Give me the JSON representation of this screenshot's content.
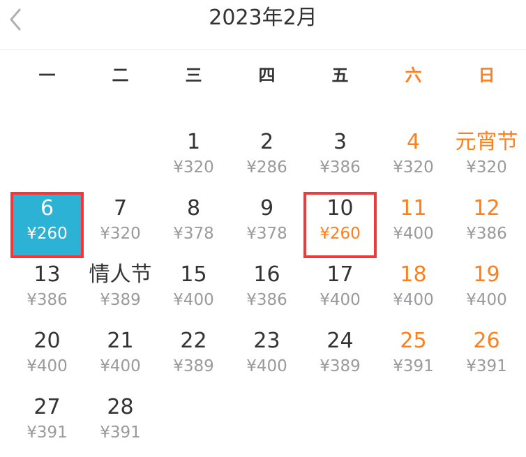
{
  "header": {
    "title": "2023年2月"
  },
  "weekdays": [
    "一",
    "二",
    "三",
    "四",
    "五",
    "六",
    "日"
  ],
  "calendar": {
    "cells": [
      {
        "day": "",
        "price": ""
      },
      {
        "day": "",
        "price": ""
      },
      {
        "day": "1",
        "price": "¥320"
      },
      {
        "day": "2",
        "price": "¥286"
      },
      {
        "day": "3",
        "price": "¥386"
      },
      {
        "day": "4",
        "price": "¥320"
      },
      {
        "day": "元宵节",
        "price": "¥320"
      },
      {
        "day": "6",
        "price": "¥260"
      },
      {
        "day": "7",
        "price": "¥320"
      },
      {
        "day": "8",
        "price": "¥378"
      },
      {
        "day": "9",
        "price": "¥378"
      },
      {
        "day": "10",
        "price": "¥260"
      },
      {
        "day": "11",
        "price": "¥400"
      },
      {
        "day": "12",
        "price": "¥386"
      },
      {
        "day": "13",
        "price": "¥386"
      },
      {
        "day": "情人节",
        "price": "¥389"
      },
      {
        "day": "15",
        "price": "¥400"
      },
      {
        "day": "16",
        "price": "¥386"
      },
      {
        "day": "17",
        "price": "¥400"
      },
      {
        "day": "18",
        "price": "¥400"
      },
      {
        "day": "19",
        "price": "¥400"
      },
      {
        "day": "20",
        "price": "¥400"
      },
      {
        "day": "21",
        "price": "¥400"
      },
      {
        "day": "22",
        "price": "¥389"
      },
      {
        "day": "23",
        "price": "¥400"
      },
      {
        "day": "24",
        "price": "¥389"
      },
      {
        "day": "25",
        "price": "¥391"
      },
      {
        "day": "26",
        "price": "¥391"
      },
      {
        "day": "27",
        "price": "¥391"
      },
      {
        "day": "28",
        "price": "¥391"
      }
    ]
  },
  "colors": {
    "weekend": "#ff7f1e",
    "selected_bg": "#2bb2d4",
    "outline": "#ff3333",
    "price": "#9a9a9a",
    "text": "#333333"
  }
}
